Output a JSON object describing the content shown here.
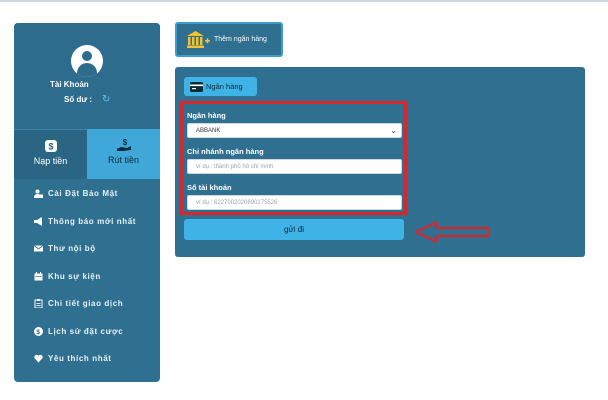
{
  "sidebar": {
    "account_label": "Tài Khoản",
    "balance_label": "Số dư :",
    "refresh_icon": "refresh-icon",
    "deposit_label": "Nạp tiền",
    "withdraw_label": "Rút tiền",
    "menu": [
      {
        "label": "Cài Đặt Bảo Mật",
        "icon": "user-lock-icon"
      },
      {
        "label": "Thông báo mới nhất",
        "icon": "megaphone-icon"
      },
      {
        "label": "Thư nội bộ",
        "icon": "envelope-icon"
      },
      {
        "label": "Khu sự kiện",
        "icon": "calendar-icon"
      },
      {
        "label": "Chi tiết giao dịch",
        "icon": "clipboard-icon"
      },
      {
        "label": "Lịch sử đặt cược",
        "icon": "coin-icon"
      },
      {
        "label": "Yêu thích nhất",
        "icon": "heart-icon"
      }
    ]
  },
  "add_bank": {
    "label": "Thêm ngân hàng",
    "icon": "bank-plus-icon"
  },
  "panel": {
    "tab_label": "Ngân hàng",
    "tab_icon": "credit-card-icon",
    "bank_label": "Ngân hàng",
    "bank_value": "ABBANK",
    "branch_label": "Chi nhánh ngân hàng",
    "branch_placeholder": "ví dụ : thành phố hồ chí minh",
    "account_label": "Số tài khoản",
    "account_placeholder": "ví dụ : 6227002020690175526",
    "submit_label": "gửi đi"
  },
  "colors": {
    "panel": "#2f6f8f",
    "accent": "#3fb3e6",
    "highlight": "#d8262d"
  }
}
